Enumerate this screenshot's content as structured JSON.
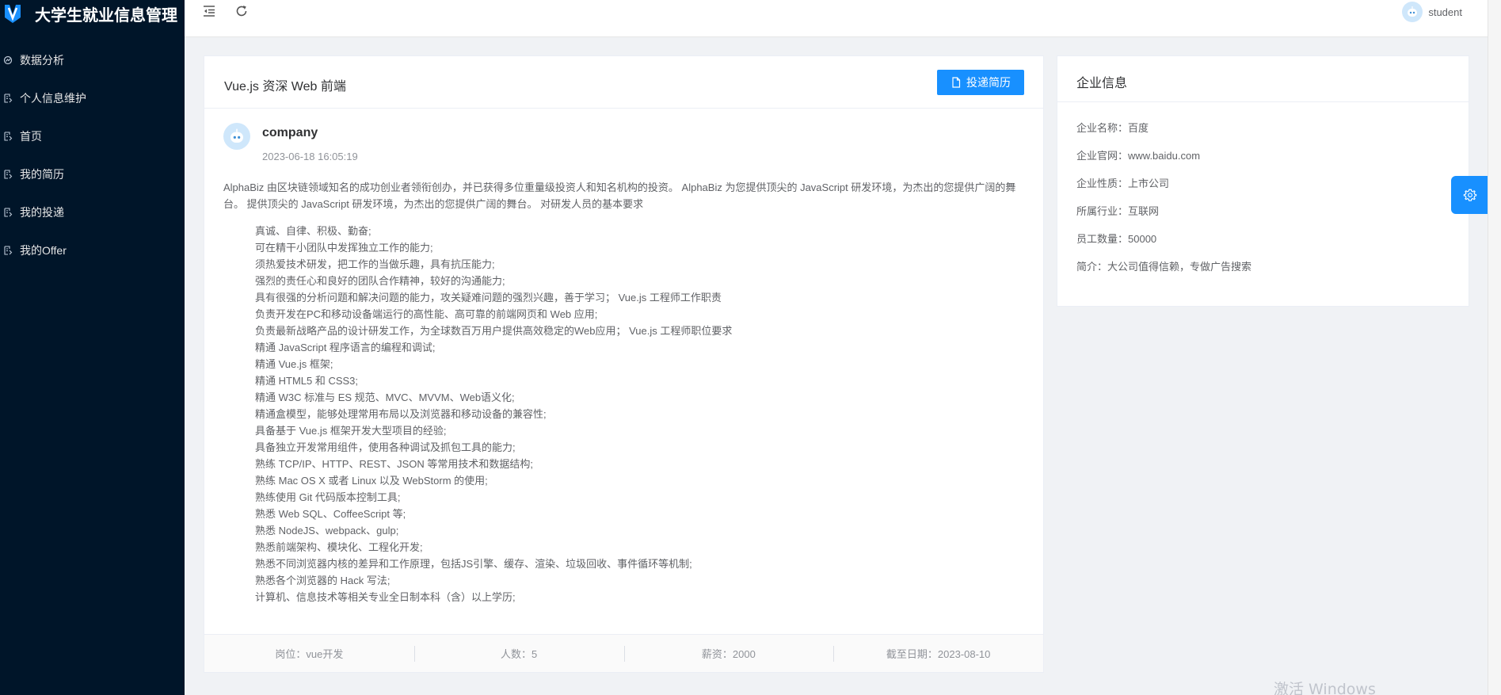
{
  "app": {
    "title": "大学生就业信息管理",
    "brand_color": "#1890ff",
    "sidebar_bg": "#001529"
  },
  "sidebar": {
    "items": [
      {
        "label": "数据分析",
        "icon": "chart-icon"
      },
      {
        "label": "个人信息维护",
        "icon": "document-icon"
      },
      {
        "label": "首页",
        "icon": "document-icon"
      },
      {
        "label": "我的简历",
        "icon": "document-icon"
      },
      {
        "label": "我的投递",
        "icon": "document-icon"
      },
      {
        "label": "我的Offer",
        "icon": "document-icon"
      }
    ]
  },
  "header": {
    "collapse_icon": "collapse-menu-icon",
    "refresh_icon": "refresh-icon",
    "username": "student"
  },
  "job": {
    "title": "Vue.js 资深 Web 前端",
    "apply_label": "投递简历",
    "poster_name": "company",
    "post_time": "2023-06-18 16:05:19",
    "intro": "AlphaBiz 由区块链领域知名的成功创业者领衔创办，并已获得多位重量级投资人和知名机构的投资。 AlphaBiz 为您提供顶尖的 JavaScript 研发环境，为杰出的您提供广阔的舞台。 提供顶尖的 JavaScript 研发环境，为杰出的您提供广阔的舞台。 对研发人员的基本要求",
    "requirements": [
      "真诚、自律、积极、勤奋;",
      "可在精干小团队中发挥独立工作的能力;",
      "须热爱技术研发，把工作的当做乐趣，具有抗压能力;",
      "强烈的责任心和良好的团队合作精神，较好的沟通能力;",
      "具有很强的分析问题和解决问题的能力，攻关疑难问题的强烈兴趣，善于学习； Vue.js 工程师工作职责",
      "负责开发在PC和移动设备端运行的高性能、高可靠的前端网页和 Web 应用;",
      "负责最新战略产品的设计研发工作，为全球数百万用户提供高效稳定的Web应用； Vue.js 工程师职位要求",
      "精通 JavaScript 程序语言的编程和调试;",
      "精通 Vue.js 框架;",
      "精通 HTML5 和 CSS3;",
      "精通 W3C 标准与 ES 规范、MVC、MVVM、Web语义化;",
      "精通盒模型，能够处理常用布局以及浏览器和移动设备的兼容性;",
      "具备基于 Vue.js 框架开发大型项目的经验;",
      "具备独立开发常用组件，使用各种调试及抓包工具的能力;",
      "熟练 TCP/IP、HTTP、REST、JSON 等常用技术和数据结构;",
      "熟练 Mac OS X 或者 Linux 以及 WebStorm 的使用;",
      "熟练使用 Git 代码版本控制工具;",
      "熟悉 Web SQL、CoffeeScript 等;",
      "熟悉 NodeJS、webpack、gulp;",
      "熟悉前端架构、模块化、工程化开发;",
      "熟悉不同浏览器内核的差异和工作原理，包括JS引擎、缓存、渲染、垃圾回收、事件循环等机制;",
      "熟悉各个浏览器的 Hack 写法;",
      "计算机、信息技术等相关专业全日制本科（含）以上学历;"
    ],
    "footer": {
      "position": "岗位：vue开发",
      "headcount": "人数：5",
      "salary": "薪资：2000",
      "deadline": "截至日期：2023-08-10"
    }
  },
  "company": {
    "section_title": "企业信息",
    "fields": [
      "企业名称：百度",
      "企业官网：www.baidu.com",
      "企业性质：上市公司",
      "所属行业：互联网",
      "员工数量：50000",
      "简介：大公司值得信赖，专做广告搜索"
    ]
  },
  "settings": {
    "icon": "gear-icon"
  },
  "watermark": "激活 Windows"
}
